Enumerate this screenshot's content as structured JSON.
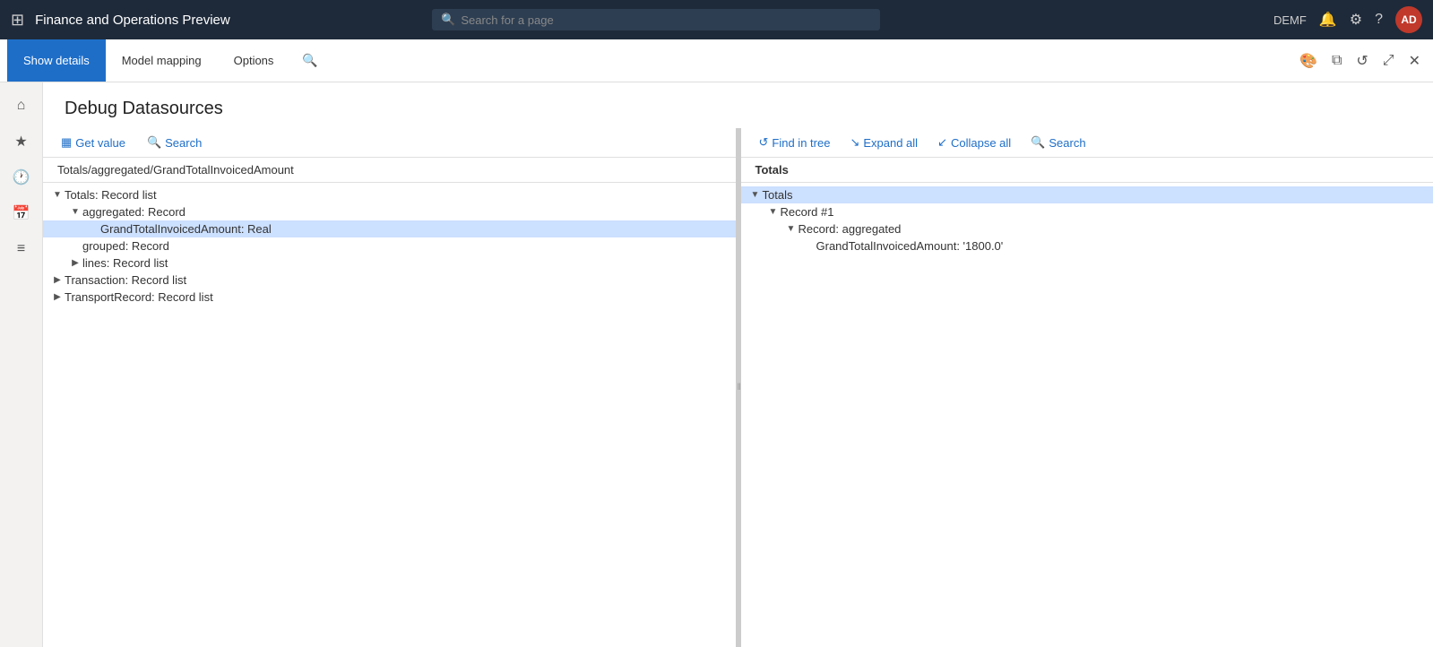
{
  "app": {
    "title": "Finance and Operations Preview",
    "search_placeholder": "Search for a page",
    "user": "DEMF",
    "avatar": "AD"
  },
  "toolbar": {
    "tabs": [
      {
        "id": "show-details",
        "label": "Show details",
        "active": true
      },
      {
        "id": "model-mapping",
        "label": "Model mapping",
        "active": false
      },
      {
        "id": "options",
        "label": "Options",
        "active": false
      }
    ]
  },
  "page": {
    "title": "Debug Datasources"
  },
  "left_pane": {
    "get_value_label": "Get value",
    "search_label": "Search",
    "path": "Totals/aggregated/GrandTotalInvoicedAmount",
    "tree": [
      {
        "id": "totals",
        "label": "Totals: Record list",
        "expanded": true,
        "indent": 0,
        "toggle": "▼",
        "children": [
          {
            "id": "aggregated",
            "label": "aggregated: Record",
            "expanded": true,
            "indent": 1,
            "toggle": "▼",
            "children": [
              {
                "id": "grandtotal",
                "label": "GrandTotalInvoicedAmount: Real",
                "expanded": false,
                "indent": 2,
                "toggle": "",
                "selected": true,
                "children": []
              }
            ]
          },
          {
            "id": "grouped",
            "label": "grouped: Record",
            "expanded": false,
            "indent": 1,
            "toggle": "",
            "children": []
          },
          {
            "id": "lines",
            "label": "lines: Record list",
            "expanded": false,
            "indent": 1,
            "toggle": "▶",
            "children": []
          }
        ]
      },
      {
        "id": "transaction",
        "label": "Transaction: Record list",
        "expanded": false,
        "indent": 0,
        "toggle": "▶",
        "children": []
      },
      {
        "id": "transportrecord",
        "label": "TransportRecord: Record list",
        "expanded": false,
        "indent": 0,
        "toggle": "▶",
        "children": []
      }
    ]
  },
  "right_pane": {
    "find_tree_label": "Find in tree",
    "expand_all_label": "Expand all",
    "collapse_all_label": "Collapse all",
    "search_label": "Search",
    "root_label": "Totals",
    "tree": [
      {
        "id": "r-totals",
        "label": "Totals",
        "expanded": true,
        "indent": 0,
        "toggle": "▼",
        "selected": true,
        "children": [
          {
            "id": "r-record1",
            "label": "Record #1",
            "expanded": true,
            "indent": 1,
            "toggle": "▼",
            "children": [
              {
                "id": "r-aggregated",
                "label": "Record: aggregated",
                "expanded": true,
                "indent": 2,
                "toggle": "▼",
                "children": [
                  {
                    "id": "r-grandtotal",
                    "label": "GrandTotalInvoicedAmount: '1800.0'",
                    "expanded": false,
                    "indent": 3,
                    "toggle": "",
                    "children": []
                  }
                ]
              }
            ]
          }
        ]
      }
    ]
  },
  "icons": {
    "grid": "⊞",
    "search": "🔍",
    "notification": "🔔",
    "settings": "⚙",
    "help": "?",
    "home": "⌂",
    "star": "★",
    "recent": "🕐",
    "calendar": "📅",
    "list": "≡",
    "palette": "🎨",
    "window": "⧉",
    "refresh": "↺",
    "popout": "⤢",
    "close": "✕",
    "find_tree": "↺",
    "expand": "↘",
    "collapse": "↙",
    "get_value": "▦"
  }
}
